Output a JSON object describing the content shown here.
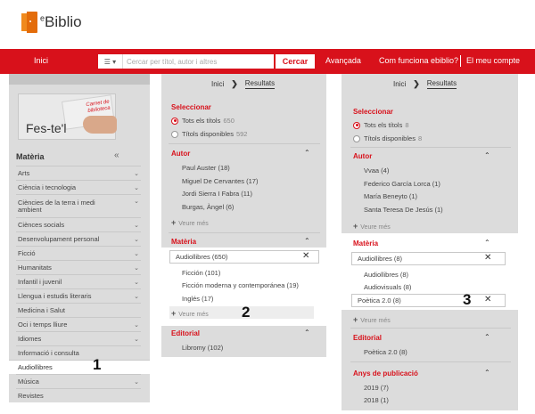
{
  "logo": {
    "text_e": "e",
    "text_rest": "Biblio"
  },
  "nav": {
    "home": "Inici",
    "search_placeholder": "Cercar per títol, autor i altres",
    "search_menu": "☰ ▾",
    "search_button": "Cercar",
    "advanced": "Avançada",
    "how": "Com funciona ebiblio?",
    "account": "El meu compte"
  },
  "banner": {
    "card_text": "Carnet de biblioteca",
    "slogan": "Fes-te'l"
  },
  "sidebar": {
    "heading": "Matèria",
    "collapse_icon": "«",
    "items": [
      {
        "label": "Arts",
        "chev": "⌄"
      },
      {
        "label": "Ciència i tecnologia",
        "chev": "⌄"
      },
      {
        "label": "Ciències de la terra i medi ambient",
        "chev": "⌄"
      },
      {
        "label": "Ciènces socials",
        "chev": "⌄"
      },
      {
        "label": "Desenvolupament personal",
        "chev": "⌄"
      },
      {
        "label": "Ficció",
        "chev": "⌄"
      },
      {
        "label": "Humanitats",
        "chev": "⌄"
      },
      {
        "label": "Infantil i juvenil",
        "chev": "⌄"
      },
      {
        "label": "Llengua i estudis literaris",
        "chev": "⌄"
      },
      {
        "label": "Medicina i Salut",
        "chev": ""
      },
      {
        "label": "Oci i temps lliure",
        "chev": "⌄"
      },
      {
        "label": "Idiomes",
        "chev": "⌄"
      },
      {
        "label": "Informació i consulta",
        "chev": ""
      },
      {
        "label": "Audiollibres",
        "chev": ""
      },
      {
        "label": "Música",
        "chev": "⌄"
      },
      {
        "label": "Revistes",
        "chev": ""
      }
    ],
    "callout": "1"
  },
  "panel2": {
    "crumb_home": "Inici",
    "crumb_sep": "❯",
    "crumb_current": "Resultats",
    "select_title": "Seleccionar",
    "opt_all": "Tots els títols",
    "opt_all_count": "650",
    "opt_avail": "Títols disponibles",
    "opt_avail_count": "592",
    "author_title": "Autor",
    "authors": [
      "Paul Auster (18)",
      "Miguel De Cervantes (17)",
      "Jordi Sierra I Fabra (11)",
      "Burgas, Àngel (6)"
    ],
    "more": "Veure més",
    "plus": "+",
    "subject_title": "Matèria",
    "subject_selected": "Audiollibres (650)",
    "subjects": [
      "Ficción (101)",
      "Ficción moderna y contemporánea (19)",
      "Inglés (17)"
    ],
    "editorial_title": "Editorial",
    "editorial_first": "Libromy (102)",
    "callout": "2",
    "caret": "⌃",
    "close": "✕"
  },
  "panel3": {
    "crumb_home": "Inici",
    "crumb_sep": "❯",
    "crumb_current": "Resultats",
    "select_title": "Seleccionar",
    "opt_all": "Tots els títols",
    "opt_all_count": "8",
    "opt_avail": "Títols disponibles",
    "opt_avail_count": "8",
    "author_title": "Autor",
    "authors": [
      "Vvaa (4)",
      "Federico García Lorca (1)",
      "María Beneyto (1)",
      "Santa Teresa De Jesús (1)"
    ],
    "more": "Veure més",
    "plus": "+",
    "subject_title": "Matèria",
    "subject_selected_1": "Audiollibres (8)",
    "subjects": [
      "Audiollibres (8)",
      "Audiovisuals (8)"
    ],
    "subject_selected_2": "Poètica 2.0 (8)",
    "editorial_title": "Editorial",
    "editorial_first": "Poètica 2.0 (8)",
    "years_title": "Anys de publicació",
    "years": [
      "2019 (7)",
      "2018 (1)"
    ],
    "callout": "3",
    "caret": "⌃",
    "close": "✕"
  }
}
